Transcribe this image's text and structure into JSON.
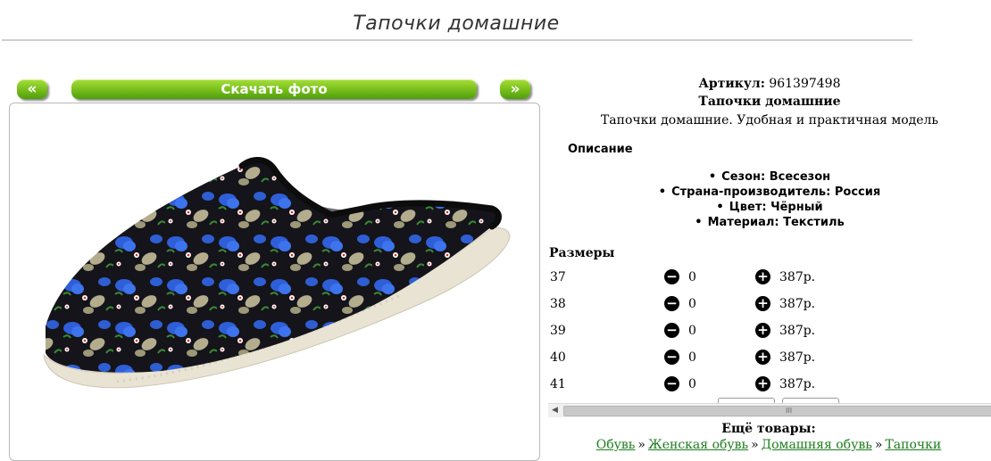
{
  "page": {
    "title": "Тапочки домашние"
  },
  "gallery": {
    "prev_label": "«",
    "download_label": "Скачать фото",
    "next_label": "»"
  },
  "product": {
    "article_label": "Артикул:",
    "article_value": "961397498",
    "name": "Тапочки домашние",
    "tagline": "Тапочки домашние. Удобная и практичная модель",
    "description_heading": "Описание",
    "features": [
      "Сезон: Всесезон",
      "Страна-производитель: Россия",
      "Цвет: Чёрный",
      "Материал: Текстиль"
    ]
  },
  "sizes": {
    "heading": "Размеры",
    "rows": [
      {
        "size": "37",
        "qty": "0",
        "price": "387р."
      },
      {
        "size": "38",
        "qty": "0",
        "price": "387р."
      },
      {
        "size": "39",
        "qty": "0",
        "price": "387р."
      },
      {
        "size": "40",
        "qty": "0",
        "price": "387р."
      },
      {
        "size": "41",
        "qty": "0",
        "price": "387р."
      }
    ]
  },
  "scrollbar": {
    "grip": "III"
  },
  "more": {
    "heading": "Ещё товары:",
    "breadcrumbs": [
      "Обувь",
      "Женская обувь",
      "Домашняя обувь",
      "Тапочки"
    ],
    "separator": "»"
  },
  "icons": {
    "minus": "minus-circle-icon",
    "plus": "plus-circle-icon",
    "scroll_left": "chevron-left-icon"
  },
  "colors": {
    "button_green": "#7ec41e",
    "link_green": "#1d7d1d",
    "slipper_blue": "#2f5fd8"
  }
}
